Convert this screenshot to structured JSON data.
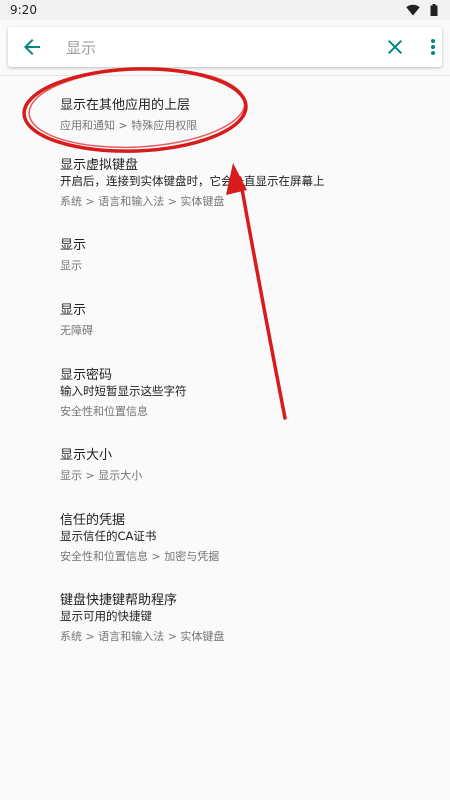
{
  "status_bar": {
    "time": "9:20",
    "icons": [
      "wifi-icon",
      "battery-icon"
    ]
  },
  "search": {
    "back_icon": "arrow-back-icon",
    "query": "显示",
    "clear_icon": "close-icon",
    "more_icon": "more-vert-icon"
  },
  "results": [
    {
      "title": "显示在其他应用的上层",
      "path": "应用和通知 > 特殊应用权限"
    },
    {
      "title": "显示虚拟键盘",
      "summary": "开启后，连接到实体键盘时，它会一直显示在屏幕上",
      "path": "系统 > 语言和输入法 > 实体键盘"
    },
    {
      "title": "显示",
      "path": "显示"
    },
    {
      "title": "显示",
      "path": "无障碍"
    },
    {
      "title": "显示密码",
      "summary": "输入时短暂显示这些字符",
      "path": "安全性和位置信息"
    },
    {
      "title": "显示大小",
      "path": "显示 > 显示大小"
    },
    {
      "title": "信任的凭据",
      "summary": "显示信任的CA证书",
      "path": "安全性和位置信息 > 加密与凭据"
    },
    {
      "title": "键盘快捷键帮助程序",
      "summary": "显示可用的快捷键",
      "path": "系统 > 语言和输入法 > 实体键盘"
    }
  ],
  "colors": {
    "accent": "#00897b",
    "annotation_red": "#d81b1b",
    "background": "#fafafa"
  }
}
